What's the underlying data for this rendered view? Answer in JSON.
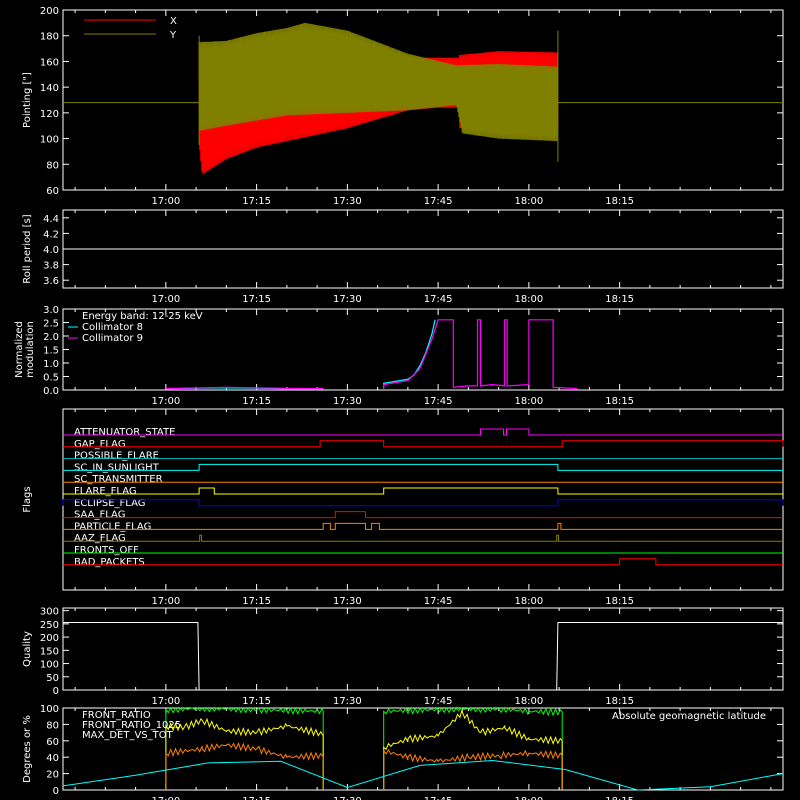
{
  "chart_data": [
    {
      "type": "line",
      "panel": "pointing",
      "ylabel": "Pointing [\"]",
      "ylim": [
        60,
        200
      ],
      "yticks": [
        60,
        80,
        100,
        120,
        140,
        160,
        180,
        200
      ],
      "x_tick_labels": [
        "17:00",
        "17:15",
        "17:30",
        "17:45",
        "18:00",
        "18:15"
      ],
      "x_ticks_min": [
        960,
        975,
        990,
        1005,
        1020,
        1035
      ],
      "x_range_min": [
        943,
        1062
      ],
      "legend": "top-left",
      "series": [
        {
          "name": "X",
          "color": "#ff0000",
          "t_start": 965.5,
          "t_end": 1008.5,
          "envelope_hi": [
            [
              965.5,
              160
            ],
            [
              970,
              160
            ],
            [
              980,
              164
            ],
            [
              990,
              163
            ],
            [
              1000,
              163
            ],
            [
              1005,
              163
            ],
            [
              1008.5,
              163
            ]
          ],
          "envelope_lo": [
            [
              965.5,
              95
            ],
            [
              966,
              72
            ],
            [
              970,
              84
            ],
            [
              975,
              93
            ],
            [
              980,
              98
            ],
            [
              990,
              108
            ],
            [
              1000,
              122
            ],
            [
              1005,
              124
            ],
            [
              1008.5,
              124
            ]
          ]
        },
        {
          "name": "X",
          "color": "#ff0000",
          "t_start": 1008.5,
          "t_end": 1024.8,
          "envelope_hi": [
            [
              1008.5,
              165
            ],
            [
              1015,
              168
            ],
            [
              1024.8,
              167
            ]
          ],
          "envelope_lo": [
            [
              1008.5,
              108
            ],
            [
              1015,
              108
            ],
            [
              1024.8,
              110
            ]
          ]
        },
        {
          "name": "Y",
          "color": "#808000",
          "t_start": 965.5,
          "t_end": 1024.8,
          "envelope_hi": [
            [
              965.5,
              175
            ],
            [
              970,
              176
            ],
            [
              975,
              182
            ],
            [
              980,
              186
            ],
            [
              983,
              190
            ],
            [
              990,
              184
            ],
            [
              995,
              175
            ],
            [
              1000,
              166
            ],
            [
              1008,
              157
            ],
            [
              1015,
              158
            ],
            [
              1024.8,
              156
            ]
          ],
          "envelope_lo": [
            [
              965.5,
              106
            ],
            [
              970,
              110
            ],
            [
              975,
              114
            ],
            [
              980,
              118
            ],
            [
              990,
              120
            ],
            [
              1000,
              122
            ],
            [
              1008,
              126
            ],
            [
              1009,
              104
            ],
            [
              1015,
              100
            ],
            [
              1024.8,
              98
            ]
          ],
          "baseline": 128
        }
      ]
    },
    {
      "type": "line",
      "panel": "roll-period",
      "ylabel": "Roll period [s]",
      "ylim": [
        3.5,
        4.5
      ],
      "yticks": [
        3.6,
        3.8,
        4.0,
        4.2,
        4.4
      ],
      "x_tick_labels": [
        "17:00",
        "17:15",
        "17:30",
        "17:45",
        "18:00",
        "18:15"
      ],
      "series": [
        {
          "color": "#ffffff",
          "x": [
            943,
            1062
          ],
          "y": [
            4.0,
            4.0
          ]
        }
      ]
    },
    {
      "type": "line",
      "panel": "modulation",
      "ylabel": "Normalized modulation",
      "ylabel_lines": [
        "Normalized",
        "modulation"
      ],
      "ylim": [
        0,
        3
      ],
      "yticks": [
        0.0,
        0.5,
        1.0,
        1.5,
        2.0,
        2.5,
        3.0
      ],
      "x_tick_labels": [
        "17:00",
        "17:15",
        "17:30",
        "17:45",
        "18:00",
        "18:15"
      ],
      "legend": "top-left",
      "legend_entries": [
        {
          "text": "Energy band: 12-25 keV",
          "color": "#ffffff"
        },
        {
          "text": "Collimator 8",
          "color": "#00ffff"
        },
        {
          "text": "Collimator 9",
          "color": "#ff00ff"
        }
      ],
      "series": [
        {
          "name": "Collimator 8",
          "color": "#00ffff",
          "x": [
            960,
            970,
            980,
            986,
            986,
            996,
            996,
            1000,
            1001,
            1002,
            1003,
            1004,
            1004.5
          ],
          "y": [
            0.05,
            0.08,
            0.05,
            0.05,
            null,
            0.05,
            0.25,
            0.4,
            0.55,
            0.9,
            1.4,
            2.1,
            2.6
          ]
        },
        {
          "name": "Collimator 9",
          "color": "#ff00ff",
          "x": [
            960,
            970,
            980,
            986,
            986,
            996,
            996,
            1000,
            1002,
            1004,
            1005,
            1007.5,
            1007.5,
            1010,
            1011.5,
            1011.5,
            1012,
            1012,
            1014,
            1016,
            1016,
            1016.4,
            1016.4,
            1020,
            1020,
            1024,
            1024,
            1028
          ],
          "y": [
            0.05,
            0.1,
            0.06,
            0.05,
            null,
            0.05,
            0.2,
            0.35,
            0.8,
            1.9,
            2.6,
            2.6,
            0.1,
            0.15,
            0.15,
            2.6,
            2.6,
            0.15,
            0.2,
            0.15,
            2.6,
            2.6,
            0.15,
            0.2,
            2.6,
            2.6,
            0.1,
            0.05
          ]
        }
      ]
    },
    {
      "type": "line",
      "panel": "flags",
      "ylabel": "Flags",
      "x_tick_labels": [
        "17:00",
        "17:15",
        "17:30",
        "17:45",
        "18:00",
        "18:15"
      ],
      "flags": [
        {
          "name": "ATTENUATOR_STATE",
          "color": "#ff00ff",
          "segments": [
            [
              1012,
              1015.8
            ],
            [
              1016.3,
              1020
            ]
          ]
        },
        {
          "name": "GAP_FLAG",
          "color": "#ff0000",
          "segments": [
            [
              985.5,
              996
            ],
            [
              1025.5,
              1062
            ]
          ]
        },
        {
          "name": "POSSIBLE_FLARE",
          "color": "#00c0c0",
          "segments": []
        },
        {
          "name": "SC_IN_SUNLIGHT",
          "color": "#00ffff",
          "segments": [
            [
              965.5,
              1024.8
            ]
          ]
        },
        {
          "name": "SC_TRANSMITTER",
          "color": "#ff8000",
          "segments": []
        },
        {
          "name": "FLARE_FLAG",
          "color": "#ffff00",
          "segments": [
            [
              965.5,
              968
            ],
            [
              996,
              1024.8
            ]
          ]
        },
        {
          "name": "ECLIPSE_FLAG",
          "color": "#0000ff",
          "segments": [
            [
              943,
              965.5
            ],
            [
              1024.8,
              1062
            ]
          ]
        },
        {
          "name": "SAA_FLAG",
          "color": "#ff0000",
          "segments": [
            [
              988,
              993
            ]
          ]
        },
        {
          "name": "PARTICLE_FLAG",
          "color": "#ff8000",
          "segments": [
            [
              986,
              987.2
            ],
            [
              988,
              993
            ],
            [
              994,
              995.3
            ],
            [
              1024.8,
              1025.3
            ]
          ]
        },
        {
          "name": "AAZ_FLAG",
          "color": "#808000",
          "segments": [
            [
              965.6,
              965.9
            ],
            [
              1024.6,
              1024.9
            ]
          ]
        },
        {
          "name": "FRONTS_OFF",
          "color": "#00ff00",
          "segments": []
        },
        {
          "name": "BAD_PACKETS",
          "color": "#ff0000",
          "segments": [
            [
              1035,
              1041
            ]
          ]
        }
      ]
    },
    {
      "type": "line",
      "panel": "quality",
      "ylabel": "Quality",
      "ylim": [
        0,
        310
      ],
      "yticks": [
        0,
        50,
        100,
        150,
        200,
        250,
        300
      ],
      "x_tick_labels": [
        "17:00",
        "17:15",
        "17:30",
        "17:45",
        "18:00",
        "18:15"
      ],
      "series": [
        {
          "color": "#ffffff",
          "x": [
            943,
            965.3,
            965.5,
            1024.6,
            1024.8,
            1062
          ],
          "y": [
            255,
            255,
            0,
            0,
            255,
            255
          ]
        }
      ]
    },
    {
      "type": "line",
      "panel": "ratios",
      "ylabel": "Degrees or %",
      "ylim": [
        0,
        100
      ],
      "yticks": [
        0,
        20,
        40,
        60,
        80,
        100
      ],
      "x_tick_labels": [
        "17:00",
        "17:15",
        "17:30",
        "17:45",
        "18:00",
        "18:15"
      ],
      "legend": "top-left",
      "legend_entries": [
        {
          "text": "FRONT_RATIO",
          "color": "#ffff00"
        },
        {
          "text": "FRONT_RATIO_1025",
          "color": "#00ff00"
        },
        {
          "text": "MAX_DET_VS_TOT",
          "color": "#ff8000"
        }
      ],
      "annotation": {
        "text": "Absolute geomagnetic latitude",
        "color": "#00ffff",
        "position": "top-right"
      },
      "series": [
        {
          "name": "FRONT_RATIO_1025",
          "color": "#00ff00",
          "x": [
            960,
            960,
            966,
            975,
            986,
            986,
            null,
            996,
            996,
            1008,
            1015,
            1020,
            1025.5,
            1025.5
          ],
          "y": [
            0,
            98,
            100,
            98,
            96,
            0,
            null,
            0,
            96,
            99,
            99,
            96,
            95,
            0
          ]
        },
        {
          "name": "FRONT_RATIO",
          "color": "#ffff00",
          "x": [
            960,
            960,
            963,
            966,
            970,
            975,
            980,
            986,
            986,
            null,
            996,
            996,
            1000,
            1005,
            1009,
            1012,
            1016,
            1020,
            1025.5,
            1025.5
          ],
          "y": [
            0,
            78,
            76,
            85,
            72,
            70,
            78,
            68,
            0,
            null,
            0,
            52,
            62,
            66,
            95,
            70,
            76,
            62,
            60,
            0
          ]
        },
        {
          "name": "MAX_DET_VS_TOT",
          "color": "#ff8000",
          "x": [
            960,
            960,
            966,
            970,
            975,
            980,
            986,
            986,
            null,
            996,
            996,
            1000,
            1005,
            1010,
            1015,
            1020,
            1025.5,
            1025.5
          ],
          "y": [
            0,
            45,
            50,
            55,
            50,
            40,
            42,
            0,
            null,
            0,
            48,
            40,
            35,
            40,
            42,
            45,
            42,
            0
          ]
        },
        {
          "name": "Absolute geomagnetic latitude",
          "color": "#00ffff",
          "x": [
            943,
            955,
            967,
            979,
            990,
            1002,
            1014,
            1026,
            1038,
            1050,
            1062
          ],
          "y": [
            5,
            18,
            33,
            35,
            3,
            30,
            36,
            25,
            0,
            4,
            20
          ]
        }
      ]
    }
  ]
}
